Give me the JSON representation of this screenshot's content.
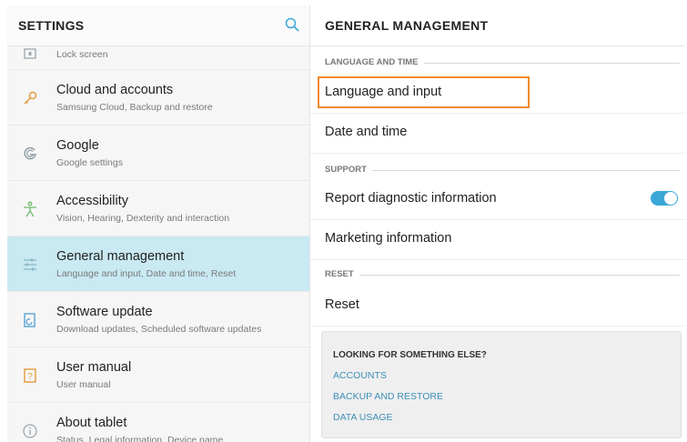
{
  "left_panel": {
    "title": "SETTINGS",
    "items": [
      {
        "title": "",
        "subtitle": "Lock screen",
        "icon": "lock-icon"
      },
      {
        "title": "Cloud and accounts",
        "subtitle": "Samsung Cloud, Backup and restore",
        "icon": "key-icon"
      },
      {
        "title": "Google",
        "subtitle": "Google settings",
        "icon": "google-icon"
      },
      {
        "title": "Accessibility",
        "subtitle": "Vision, Hearing, Dexterity and interaction",
        "icon": "accessibility-icon"
      },
      {
        "title": "General management",
        "subtitle": "Language and input, Date and time, Reset",
        "icon": "sliders-icon",
        "selected": true
      },
      {
        "title": "Software update",
        "subtitle": "Download updates, Scheduled software updates",
        "icon": "update-icon"
      },
      {
        "title": "User manual",
        "subtitle": "User manual",
        "icon": "manual-icon"
      },
      {
        "title": "About tablet",
        "subtitle": "Status, Legal information, Device name",
        "icon": "info-icon"
      }
    ]
  },
  "right_panel": {
    "title": "GENERAL MANAGEMENT",
    "sections": {
      "language_time": "LANGUAGE AND TIME",
      "support": "SUPPORT",
      "reset": "RESET"
    },
    "rows": {
      "language_input": "Language and input",
      "date_time": "Date and time",
      "report_diagnostic": "Report diagnostic information",
      "marketing": "Marketing information",
      "reset": "Reset"
    },
    "report_diagnostic_on": true,
    "looking": {
      "title": "LOOKING FOR SOMETHING ELSE?",
      "links": [
        "ACCOUNTS",
        "BACKUP AND RESTORE",
        "DATA USAGE"
      ]
    }
  },
  "colors": {
    "accent": "#3aa7d6",
    "selected_bg": "#c9e9f3",
    "highlight": "#f08a2b",
    "link": "#3e8fb8"
  }
}
